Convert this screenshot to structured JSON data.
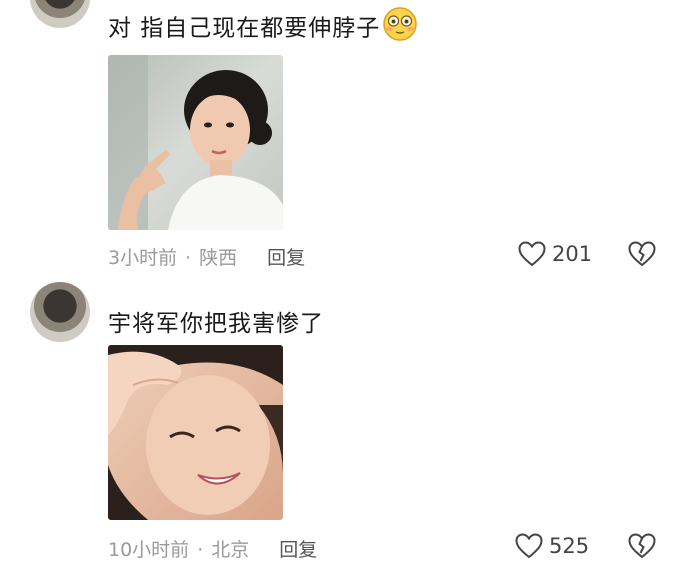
{
  "comments": [
    {
      "text": "对 指自己现在都要伸脖子",
      "emoji_icon": "flushed-face-emoji",
      "image": "girl pointing at herself",
      "time": "3小时前",
      "location": "陕西",
      "reply_label": "回复",
      "likes": "201"
    },
    {
      "text": "宇将军你把我害惨了",
      "image": "girl hand on forehead smiling",
      "time": "10小时前",
      "location": "北京",
      "reply_label": "回复",
      "likes": "525"
    }
  ],
  "separator": "·",
  "icons": {
    "like": "heart-outline-icon",
    "dislike": "broken-heart-icon"
  }
}
